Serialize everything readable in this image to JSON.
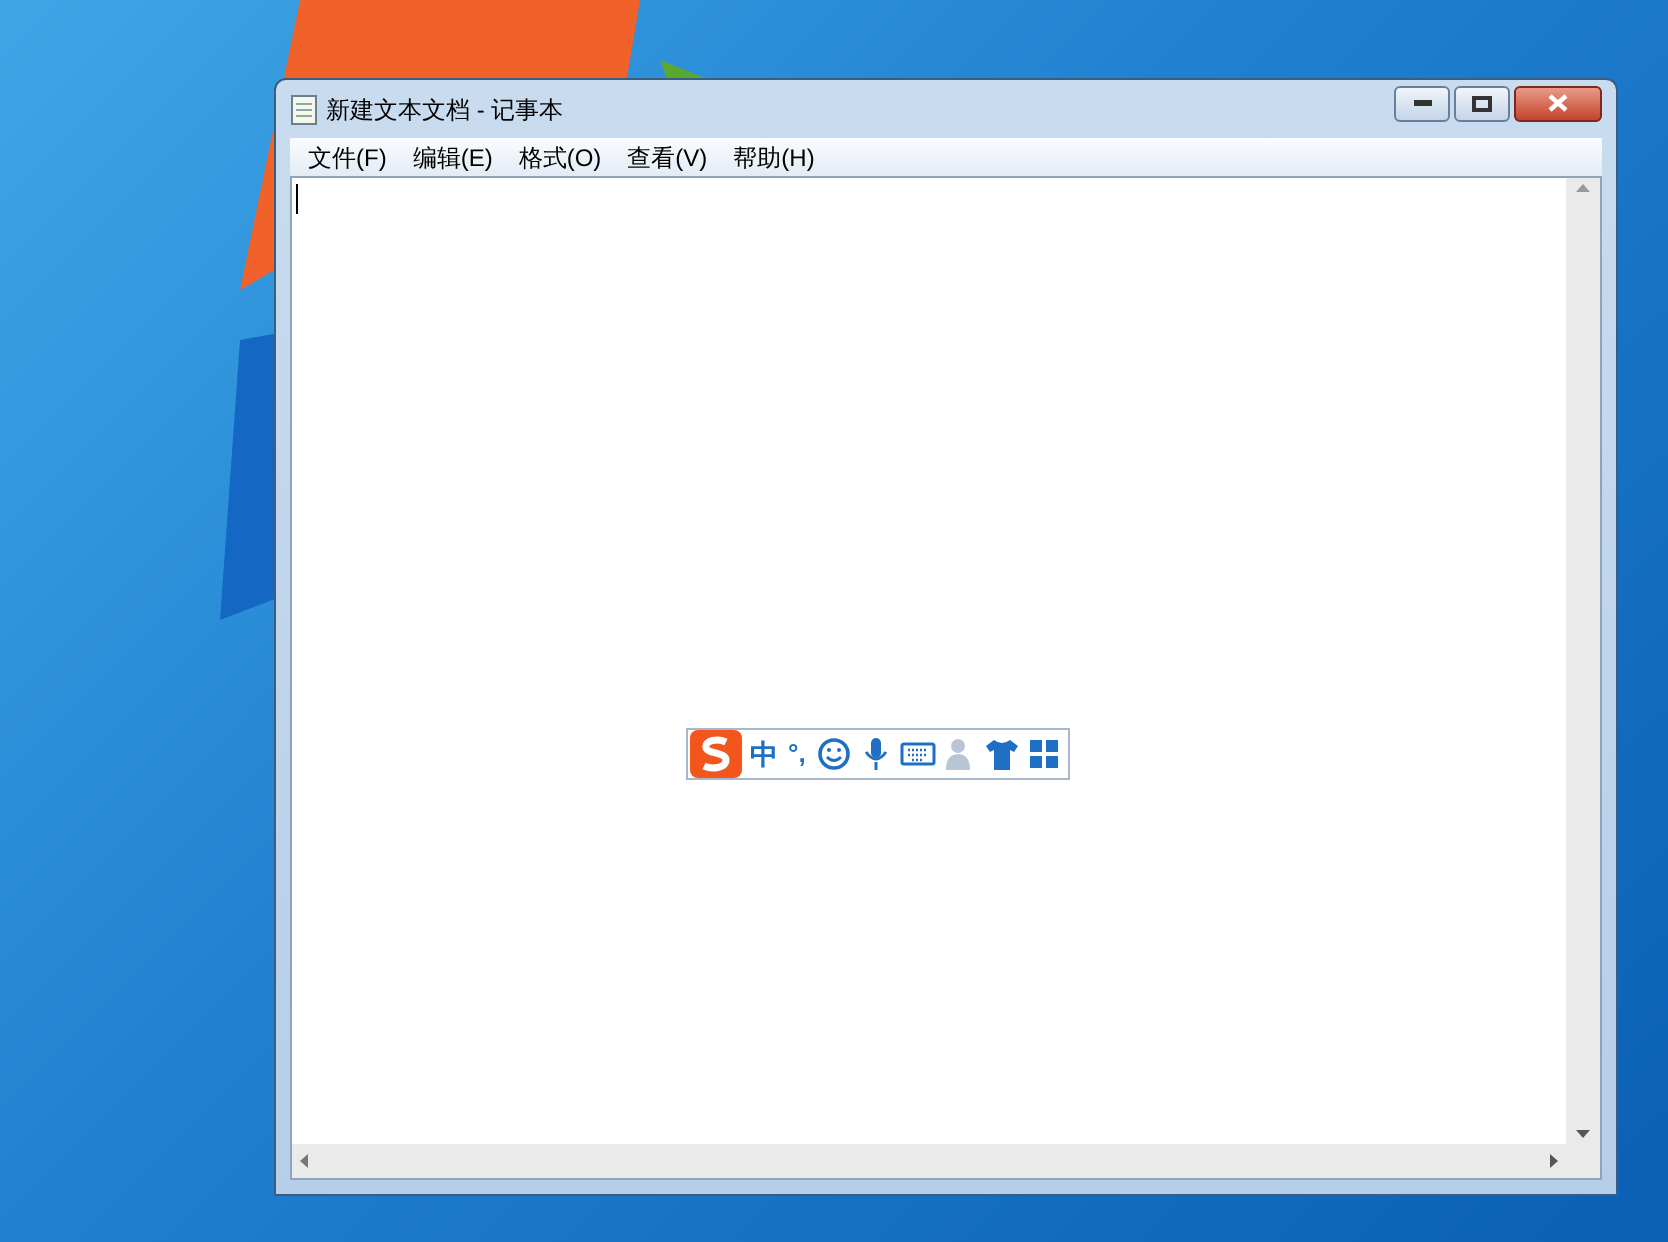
{
  "window": {
    "title": "新建文本文档 - 记事本"
  },
  "menu": [
    "文件(F)",
    "编辑(E)",
    "格式(O)",
    "查看(V)",
    "帮助(H)"
  ],
  "ime_toolbar": {
    "mode": "中",
    "punctuation": "°,"
  }
}
